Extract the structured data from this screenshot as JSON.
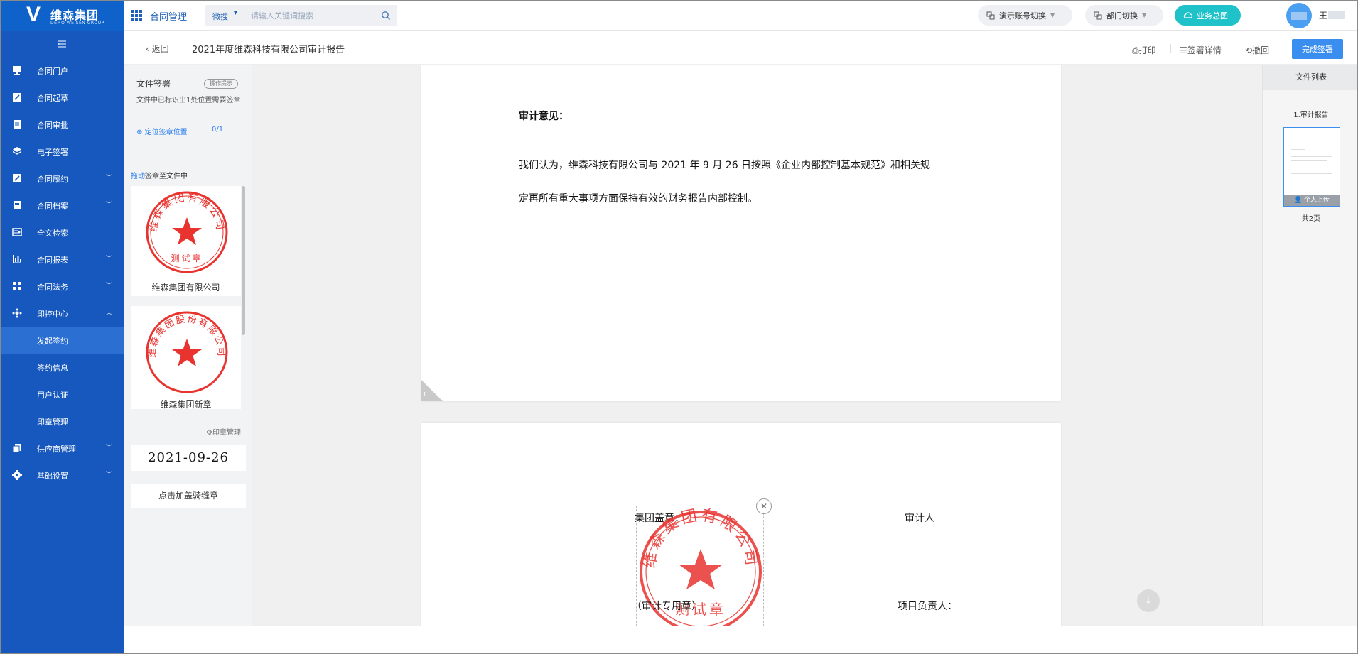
{
  "brand": {
    "mark": "V",
    "name": "维森集团",
    "sub": "DEMO WEISEN GROUP"
  },
  "header": {
    "module_title": "合同管理",
    "search_scope": "微搜",
    "search_placeholder": "请输入关键词搜索",
    "demo_switch": "演示账号切换",
    "dept_switch": "部门切换",
    "biz_overview": "业务总图",
    "user_name": "王"
  },
  "sidebar": {
    "items": [
      {
        "label": "合同门户",
        "icon": "monitor-icon"
      },
      {
        "label": "合同起草",
        "icon": "edit-icon"
      },
      {
        "label": "合同审批",
        "icon": "document-icon"
      },
      {
        "label": "电子签署",
        "icon": "layers-icon"
      },
      {
        "label": "合同履约",
        "icon": "edit-icon"
      },
      {
        "label": "合同档案",
        "icon": "archive-icon"
      },
      {
        "label": "全文检索",
        "icon": "search-card-icon"
      },
      {
        "label": "合同报表",
        "icon": "bar-chart-icon"
      },
      {
        "label": "合同法务",
        "icon": "grid-icon"
      },
      {
        "label": "印控中心",
        "icon": "seal-center-icon"
      }
    ],
    "subitems": [
      {
        "label": "发起签约"
      },
      {
        "label": "签约信息"
      },
      {
        "label": "用户认证"
      },
      {
        "label": "印章管理"
      }
    ],
    "bottom_items": [
      {
        "label": "供应商管理",
        "icon": "copy-icon"
      },
      {
        "label": "基础设置",
        "icon": "gear-icon"
      }
    ]
  },
  "subheader": {
    "back": "返回",
    "title": "2021年度维森科技有限公司审计报告",
    "print": "打印",
    "sign_detail": "签署详情",
    "undo": "撤回",
    "finish": "完成签署"
  },
  "leftpanel": {
    "title": "文件签署",
    "tip": "操作提示",
    "desc": "文件中已标识出1处位置需要签章",
    "locate": "定位签章位置",
    "locate_count": "0/1",
    "drag_hl": "拖动",
    "drag_rest": "签章至文件中",
    "seals": [
      {
        "label": "维森集团有限公司",
        "ring_text": "维森集团有限公司",
        "inner_text": "测试章",
        "color": "#e8332f"
      },
      {
        "label": "维森集团新章",
        "ring_text": "维森集团股份有限公司",
        "inner_text": "",
        "color": "#e8332f"
      }
    ],
    "seal_manage": "印章管理",
    "date": "2021-09-26",
    "straddle": "点击加盖骑缝章"
  },
  "document": {
    "heading": "审计意见：",
    "line1": "我们认为，维森科技有限公司与 2021 年 9 月 26 日按照《企业内部控制基本规范》和相关规",
    "line2": "定再所有重大事项方面保持有效的财务报告内部控制。",
    "page_number": "1",
    "group_seal_label": "集团盖章：",
    "auditor_label": "审计人",
    "audit_seal_label": "（审计专用章）",
    "manager_label": "项目负责人："
  },
  "rightpanel": {
    "title": "文件列表",
    "file": "1.审计报告",
    "tag": "个人上传",
    "pages": "共2页"
  }
}
